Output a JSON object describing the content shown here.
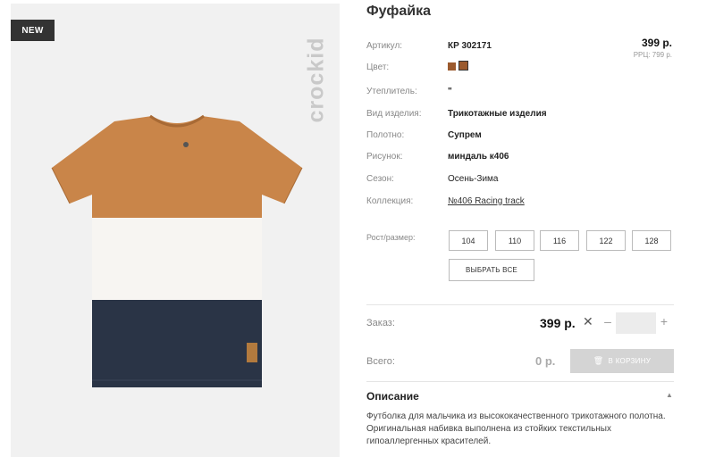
{
  "photo": {
    "badge": "NEW",
    "brand": "crockid"
  },
  "product": {
    "title": "Фуфайка",
    "price": "399 р.",
    "rrp": "РРЦ: 799 р.",
    "attributes": [
      {
        "label": "Артикул:",
        "value": "КР 302171"
      },
      {
        "label": "Цвет:",
        "value": ""
      },
      {
        "label": "Утеплитель:",
        "value": "\""
      },
      {
        "label": "Вид изделия:",
        "value": "Трикотажные изделия"
      },
      {
        "label": "Полотно:",
        "value": "Супрем"
      },
      {
        "label": "Рисунок:",
        "value": "миндаль к406"
      },
      {
        "label": "Сезон:",
        "value": "Осень-Зима"
      },
      {
        "label": "Коллекция:",
        "value": "№406 Racing track"
      }
    ],
    "colors": [
      "#9b5a2e",
      "#9b5a2e"
    ]
  },
  "sizes": {
    "label": "Рост/размер:",
    "options": [
      "104",
      "110",
      "116",
      "122",
      "128"
    ],
    "select_all": "ВЫБРАТЬ ВСЕ"
  },
  "order": {
    "label": "Заказ:",
    "price": "399 р.",
    "times": "✕",
    "minus": "–",
    "plus": "+",
    "qty": ""
  },
  "total": {
    "label": "Всего:",
    "price": "0 р.",
    "cart_button": "В КОРЗИНУ"
  },
  "description": {
    "title": "Описание",
    "toggle": "▲",
    "text": "Футболка для мальчика из высококачественного трикотажного полотна. Оригинальная набивка выполнена из стойких текстильных гипоаллергенных красителей."
  }
}
